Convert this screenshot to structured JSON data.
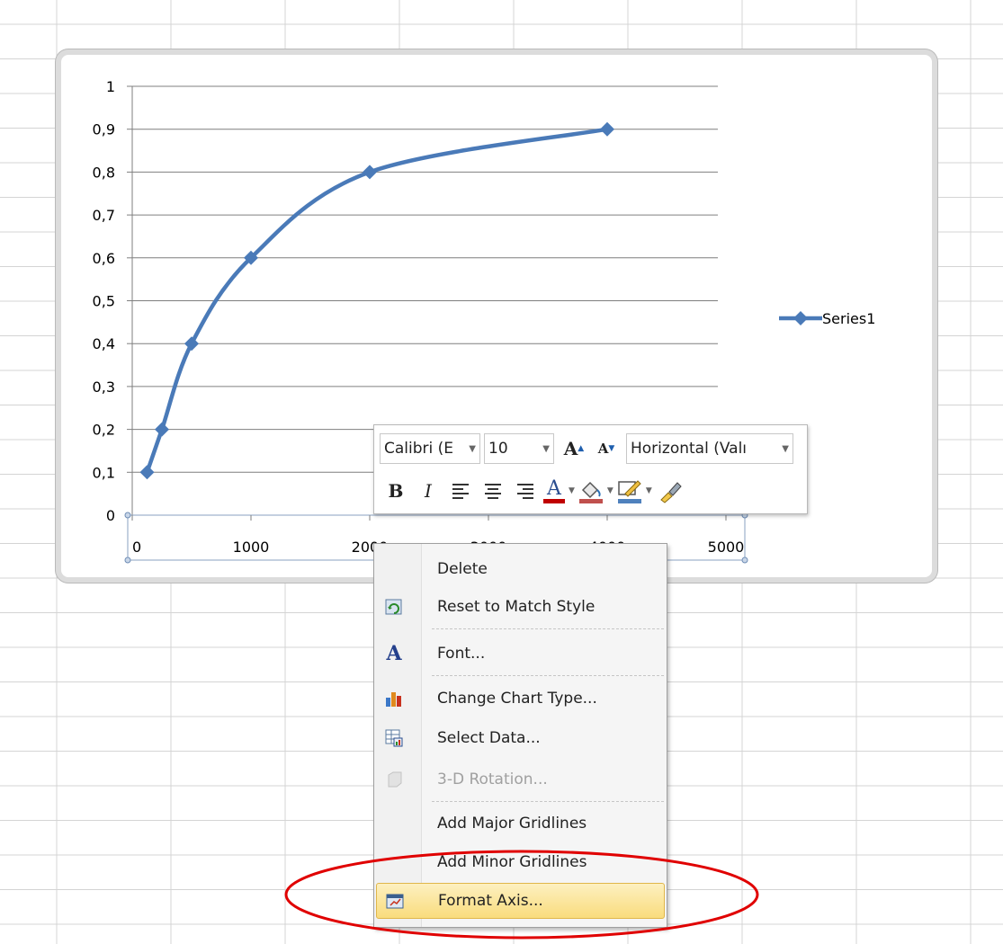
{
  "chart_data": {
    "type": "scatter",
    "title": "",
    "xlabel": "",
    "ylabel": "",
    "x_ticks": [
      "0",
      "1000",
      "2000",
      "3000",
      "4000",
      "5000"
    ],
    "y_ticks": [
      "0",
      "0,1",
      "0,2",
      "0,3",
      "0,4",
      "0,5",
      "0,6",
      "0,7",
      "0,8",
      "0,9",
      "1"
    ],
    "xlim": [
      0,
      5000
    ],
    "ylim": [
      0,
      1
    ],
    "grid": "horizontal major gridlines",
    "legend_position": "right",
    "smoothed_lines": true,
    "series": [
      {
        "name": "Series1",
        "color": "#4a7ab8",
        "marker": "diamond",
        "x": [
          125,
          250,
          500,
          1000,
          2000,
          4000
        ],
        "y": [
          0.1,
          0.2,
          0.4,
          0.6,
          0.8,
          0.9
        ]
      }
    ]
  },
  "mini_toolbar": {
    "font_name": "Calibri (E",
    "font_size": "10",
    "grow_font_icon": "A",
    "shrink_font_icon": "A",
    "element_selector": "Horizontal (Valı",
    "bold": "B",
    "italic": "I",
    "font_color_glyph": "A",
    "icons": [
      "align-left-icon",
      "align-center-icon",
      "align-right-icon",
      "font-color-icon",
      "fill-color-icon",
      "line-color-icon",
      "format-painter-icon"
    ]
  },
  "context_menu": {
    "items": [
      {
        "label": "Delete",
        "icon": "",
        "disabled": false
      },
      {
        "label": "Reset to Match Style",
        "icon": "reset-style-icon",
        "disabled": false
      },
      {
        "label": "Font...",
        "icon": "font-icon",
        "disabled": false
      },
      {
        "label": "Change Chart Type...",
        "icon": "chart-type-icon",
        "disabled": false
      },
      {
        "label": "Select Data...",
        "icon": "select-data-icon",
        "disabled": false
      },
      {
        "label": "3-D Rotation...",
        "icon": "3d-rotation-icon",
        "disabled": true
      },
      {
        "label": "Add Major Gridlines",
        "icon": "",
        "disabled": false
      },
      {
        "label": "Add Minor Gridlines",
        "icon": "",
        "disabled": false
      },
      {
        "label": "Format Axis...",
        "icon": "format-axis-icon",
        "disabled": false,
        "highlighted": true
      }
    ]
  },
  "colors": {
    "series": "#4a7ab8",
    "annotation_ellipse": "#e00000",
    "menu_highlight": "#f9dc7d",
    "font_color_bar": "#c00000",
    "fill_color_bar": "#c0504d",
    "line_color_bar": "#4f81bd"
  }
}
